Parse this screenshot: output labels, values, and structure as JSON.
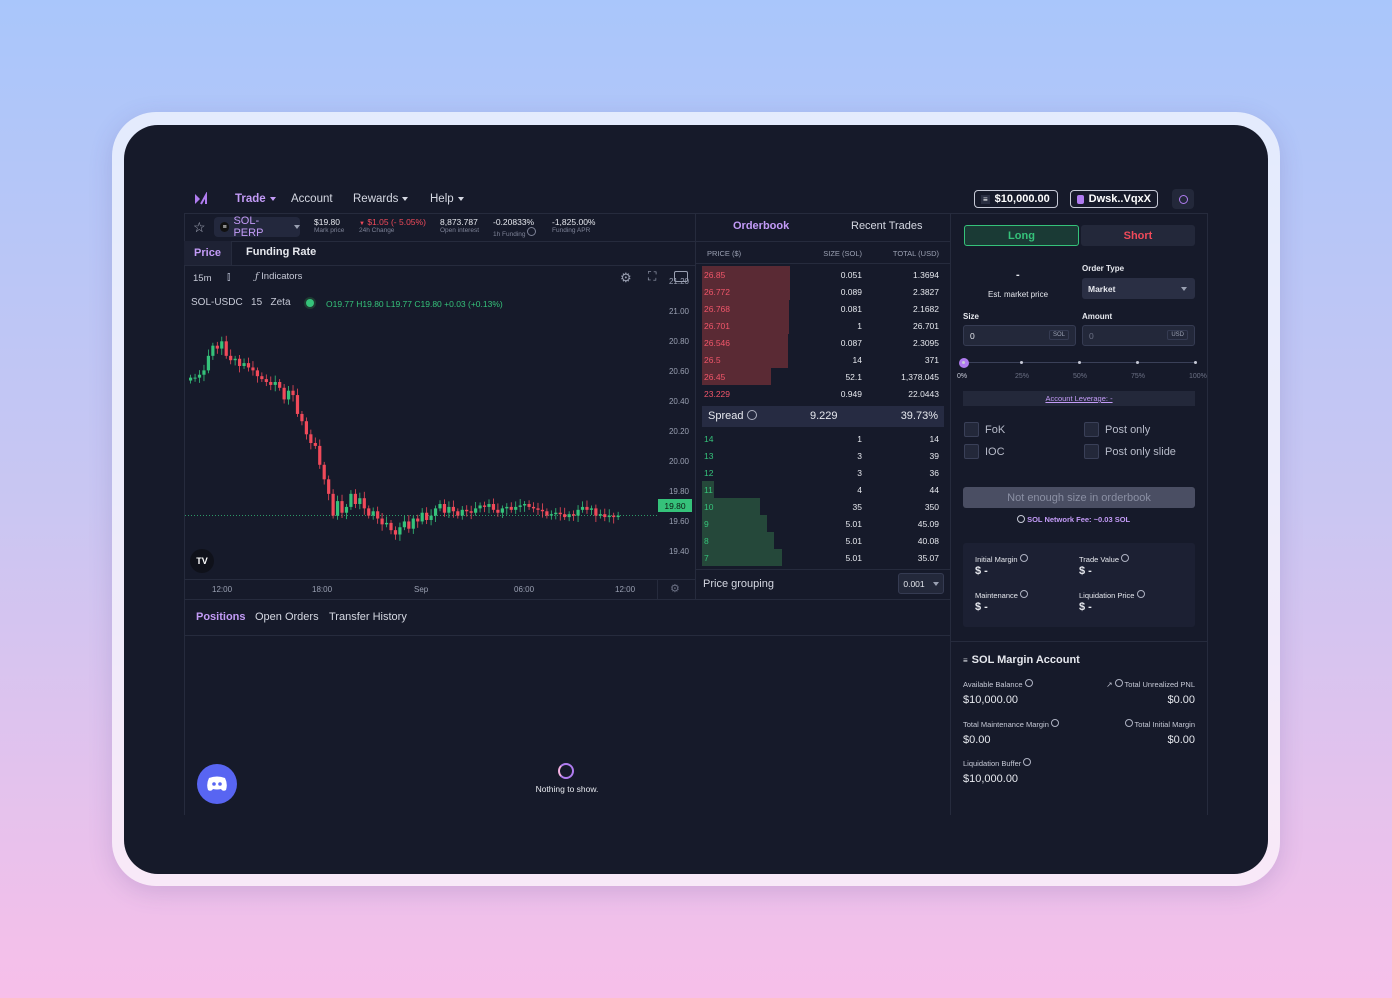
{
  "nav": {
    "trade": "Trade",
    "account": "Account",
    "rewards": "Rewards",
    "help": "Help",
    "balance": "$10,000.00",
    "wallet": "Dwsk..VqxX"
  },
  "ticker": {
    "market": "SOL-PERP",
    "mark_price": "$19.80",
    "mark_label": "Mark price",
    "change": "$1.05 (- 5.05%)",
    "change_label": "24h Change",
    "oi": "8,873.787",
    "oi_label": "Open interest",
    "funding": "-0.20833%",
    "funding_label": "1h Funding",
    "apr": "-1,825.00%",
    "apr_label": "Funding APR"
  },
  "chart_tabs": {
    "price": "Price",
    "funding": "Funding Rate"
  },
  "toolbar": {
    "interval": "15m",
    "indicators": "Indicators"
  },
  "legend": {
    "symbol": "SOL-USDC",
    "interval": "15",
    "source": "Zeta",
    "ohlc": "O19.77 H19.80 L19.77 C19.80 +0.03 (+0.13%)"
  },
  "chart_data": {
    "type": "candlestick",
    "y_ticks": [
      "21.20",
      "21.00",
      "20.80",
      "20.60",
      "20.40",
      "20.20",
      "20.00",
      "19.80",
      "19.60",
      "19.40"
    ],
    "x_ticks": [
      "12:00",
      "18:00",
      "Sep",
      "06:00",
      "12:00"
    ],
    "last_price": "19.80",
    "ylim": [
      19.35,
      21.25
    ],
    "close": [
      20.75,
      20.75,
      20.77,
      20.8,
      20.9,
      20.97,
      20.95,
      21.0,
      20.9,
      20.87,
      20.88,
      20.83,
      20.85,
      20.82,
      20.8,
      20.76,
      20.74,
      20.72,
      20.7,
      20.72,
      20.68,
      20.6,
      20.66,
      20.63,
      20.5,
      20.45,
      20.36,
      20.3,
      20.28,
      20.15,
      20.05,
      19.95,
      19.8,
      19.9,
      19.82,
      19.86,
      19.95,
      19.88,
      19.92,
      19.85,
      19.8,
      19.83,
      19.78,
      19.74,
      19.75,
      19.7,
      19.67,
      19.72,
      19.76,
      19.71,
      19.78,
      19.76,
      19.82,
      19.77,
      19.8,
      19.85,
      19.88,
      19.82,
      19.86,
      19.83,
      19.8,
      19.84,
      19.83,
      19.82,
      19.85,
      19.87,
      19.86,
      19.88,
      19.84,
      19.82,
      19.85,
      19.86,
      19.84,
      19.86,
      19.87,
      19.88,
      19.86,
      19.85,
      19.84,
      19.83,
      19.8,
      19.81,
      19.82,
      19.81,
      19.79,
      19.81,
      19.8,
      19.84,
      19.86,
      19.84,
      19.85,
      19.8,
      19.81,
      19.79,
      19.8,
      19.79,
      19.8
    ]
  },
  "orderbook": {
    "tab_orderbook": "Orderbook",
    "tab_trades": "Recent Trades",
    "h_price": "PRICE ($)",
    "h_size": "SIZE (SOL)",
    "h_total": "TOTAL (USD)",
    "asks": [
      [
        "26.85",
        "0.051",
        "1.3694",
        88
      ],
      [
        "26.772",
        "0.089",
        "2.3827",
        88
      ],
      [
        "26.768",
        "0.081",
        "2.1682",
        87
      ],
      [
        "26.701",
        "1",
        "26.701",
        87
      ],
      [
        "26.546",
        "0.087",
        "2.3095",
        86
      ],
      [
        "26.5",
        "14",
        "371",
        86
      ],
      [
        "26.45",
        "52.1",
        "1,378.045",
        69
      ],
      [
        "23.229",
        "0.949",
        "22.0443",
        0
      ]
    ],
    "spread_label": "Spread",
    "spread": "9.229",
    "spread_pct": "39.73%",
    "bids": [
      [
        "14",
        "1",
        "14",
        0
      ],
      [
        "13",
        "3",
        "39",
        0
      ],
      [
        "12",
        "3",
        "36",
        0
      ],
      [
        "11",
        "4",
        "44",
        12
      ],
      [
        "10",
        "35",
        "350",
        58
      ],
      [
        "9",
        "5.01",
        "45.09",
        65
      ],
      [
        "8",
        "5.01",
        "40.08",
        72
      ],
      [
        "7",
        "5.01",
        "35.07",
        80
      ]
    ],
    "grouping_label": "Price grouping",
    "grouping": "0.001"
  },
  "order_form": {
    "long": "Long",
    "short": "Short",
    "est": "-",
    "est_label": "Est. market price",
    "order_type_label": "Order Type",
    "order_type": "Market",
    "size_label": "Size",
    "size_value": "0",
    "size_unit": "SOL",
    "amount_label": "Amount",
    "amount_value": "0",
    "amount_unit": "USD",
    "slider_marks": [
      "0%",
      "25%",
      "50%",
      "75%",
      "100%"
    ],
    "slider_value": 0,
    "leverage": "Account Leverage: -",
    "fok": "FoK",
    "post_only": "Post only",
    "ioc": "IOC",
    "post_only_slide": "Post only slide",
    "submit": "Not enough size in orderbook",
    "fee": "SOL Network Fee: ~0.03 SOL",
    "init_margin_label": "Initial Margin",
    "init_margin": "$ -",
    "trade_value_label": "Trade Value",
    "trade_value": "$ -",
    "maint_label": "Maintenance",
    "maint": "$ -",
    "liq_label": "Liquidation Price",
    "liq": "$ -"
  },
  "margin": {
    "title": "SOL Margin Account",
    "avail_label": "Available Balance",
    "avail": "$10,000.00",
    "upnl_label": "Total Unrealized PNL",
    "upnl": "$0.00",
    "tmm_label": "Total Maintenance Margin",
    "tmm": "$0.00",
    "tim_label": "Total Initial Margin",
    "tim": "$0.00",
    "buffer_label": "Liquidation Buffer",
    "buffer": "$10,000.00"
  },
  "bottom_tabs": {
    "positions": "Positions",
    "open_orders": "Open Orders",
    "transfer": "Transfer History",
    "empty": "Nothing to show."
  },
  "colors": {
    "accent": "#b07cf0",
    "long": "#35c27a",
    "short": "#f04a5a",
    "bg": "#161a2a"
  }
}
